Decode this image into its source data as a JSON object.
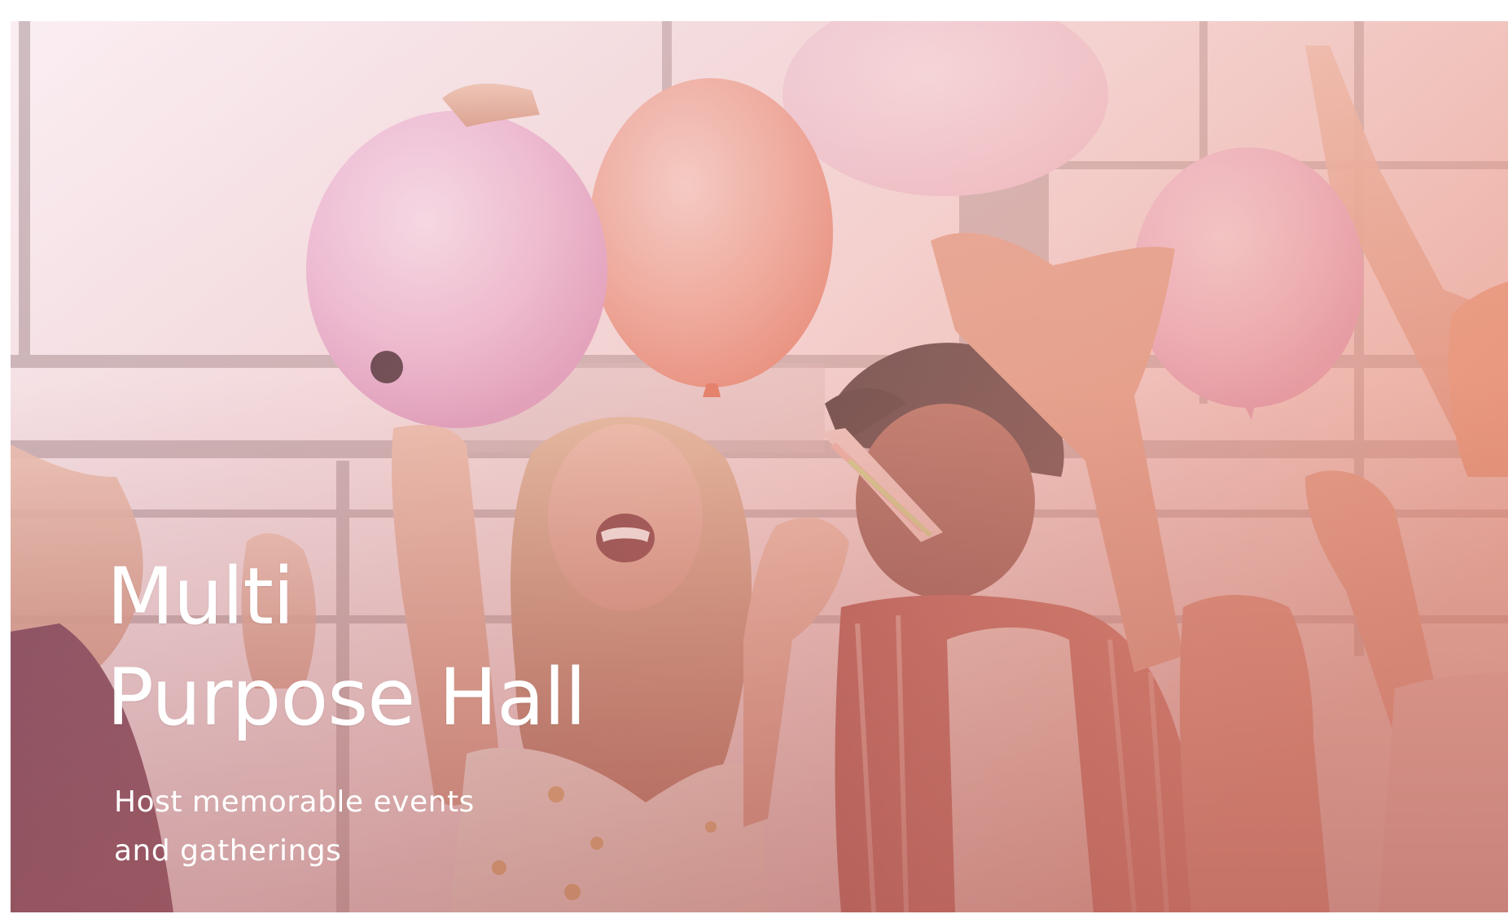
{
  "hero": {
    "title_line1": "Multi",
    "title_line2": "Purpose Hall",
    "subtitle_line1": "Host memorable events",
    "subtitle_line2": "and gatherings",
    "image_subject": "party-crowd-with-balloons-photo",
    "colors": {
      "text": "#ffffff",
      "tint": "#f6c9d2",
      "warm": "#e8917a"
    }
  }
}
